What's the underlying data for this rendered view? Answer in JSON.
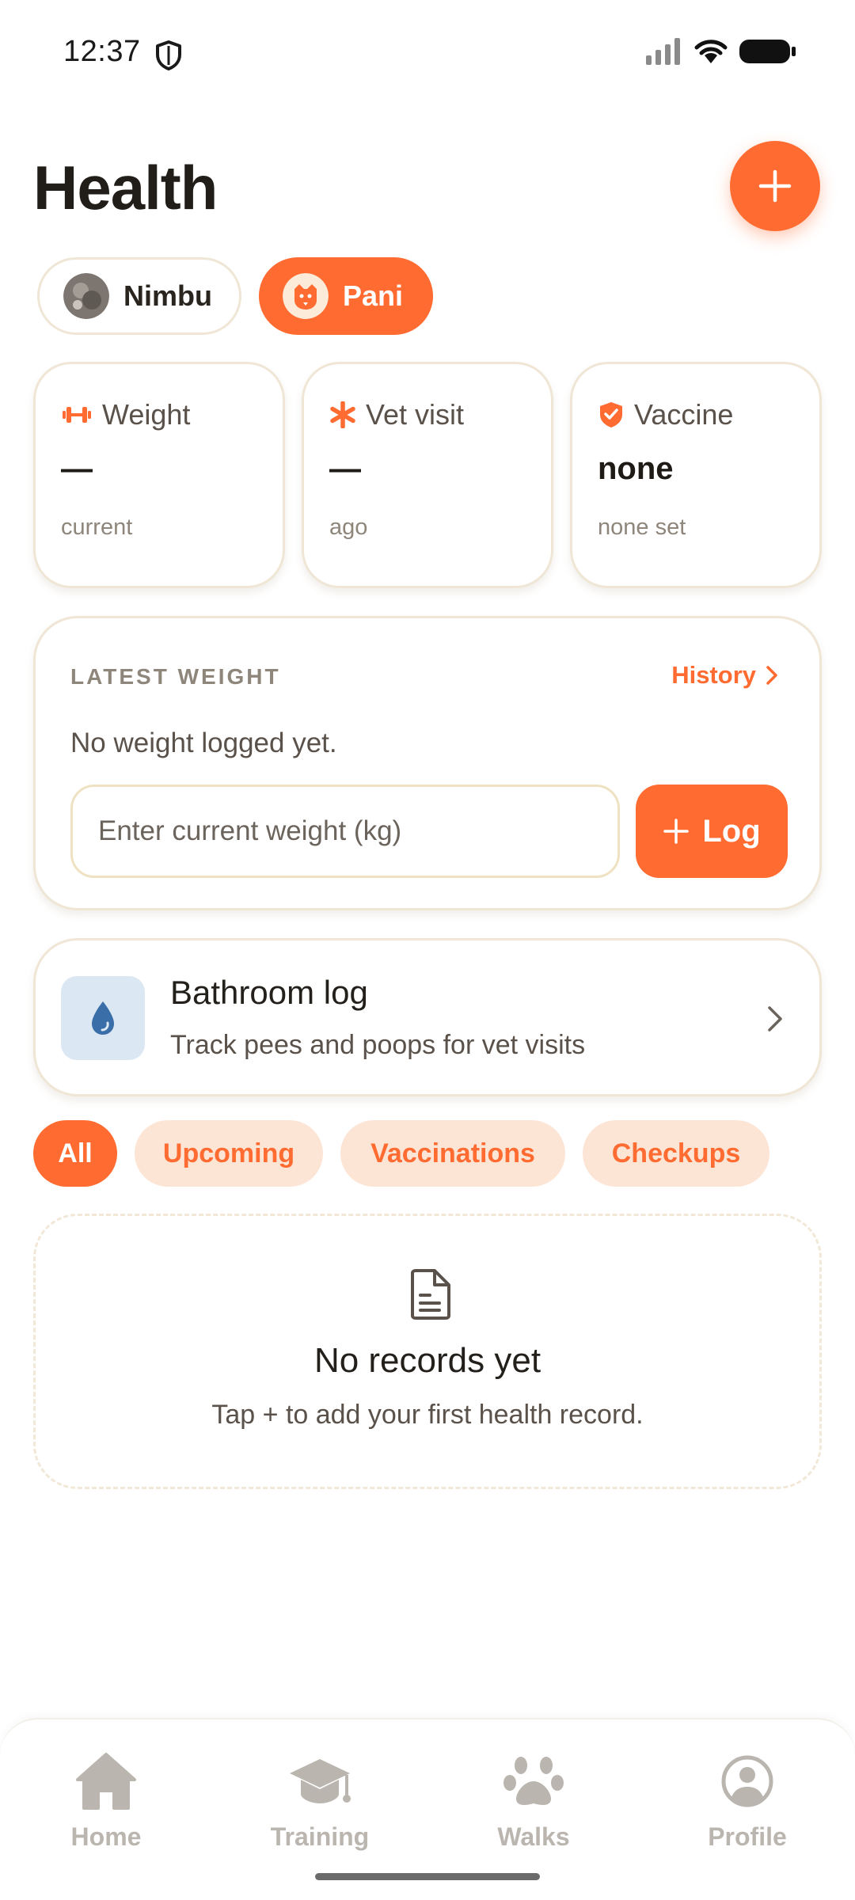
{
  "status_bar": {
    "time": "12:37"
  },
  "header": {
    "title": "Health"
  },
  "pets": [
    {
      "name": "Nimbu",
      "selected": false
    },
    {
      "name": "Pani",
      "selected": true
    }
  ],
  "stats": [
    {
      "icon": "dumbbell-icon",
      "label": "Weight",
      "value": "—",
      "sub": "current"
    },
    {
      "icon": "asterisk-icon",
      "label": "Vet visit",
      "value": "—",
      "sub": "ago"
    },
    {
      "icon": "shield-check-icon",
      "label": "Vaccine",
      "value": "none",
      "sub": "none set"
    }
  ],
  "latest_weight": {
    "section_label": "LATEST WEIGHT",
    "history_label": "History",
    "empty_text": "No weight logged yet.",
    "input_placeholder": "Enter current weight (kg)",
    "log_label": "Log"
  },
  "bathroom": {
    "title": "Bathroom log",
    "subtitle": "Track pees and poops for vet visits"
  },
  "filters": [
    {
      "label": "All",
      "active": true
    },
    {
      "label": "Upcoming",
      "active": false
    },
    {
      "label": "Vaccinations",
      "active": false
    },
    {
      "label": "Checkups",
      "active": false
    }
  ],
  "records_empty": {
    "title": "No records yet",
    "subtitle": "Tap + to add your first health record."
  },
  "nav": [
    {
      "label": "Home",
      "icon": "home-icon"
    },
    {
      "label": "Training",
      "icon": "graduation-cap-icon"
    },
    {
      "label": "Walks",
      "icon": "paw-icon"
    },
    {
      "label": "Profile",
      "icon": "profile-icon"
    }
  ],
  "colors": {
    "accent": "#ff6b30",
    "accent_soft": "#fde5d6",
    "card_border": "#efe6d6",
    "nav_inactive": "#bab5ae",
    "water_tile": "#dbe7f3",
    "water_drop": "#3a6ea8"
  }
}
